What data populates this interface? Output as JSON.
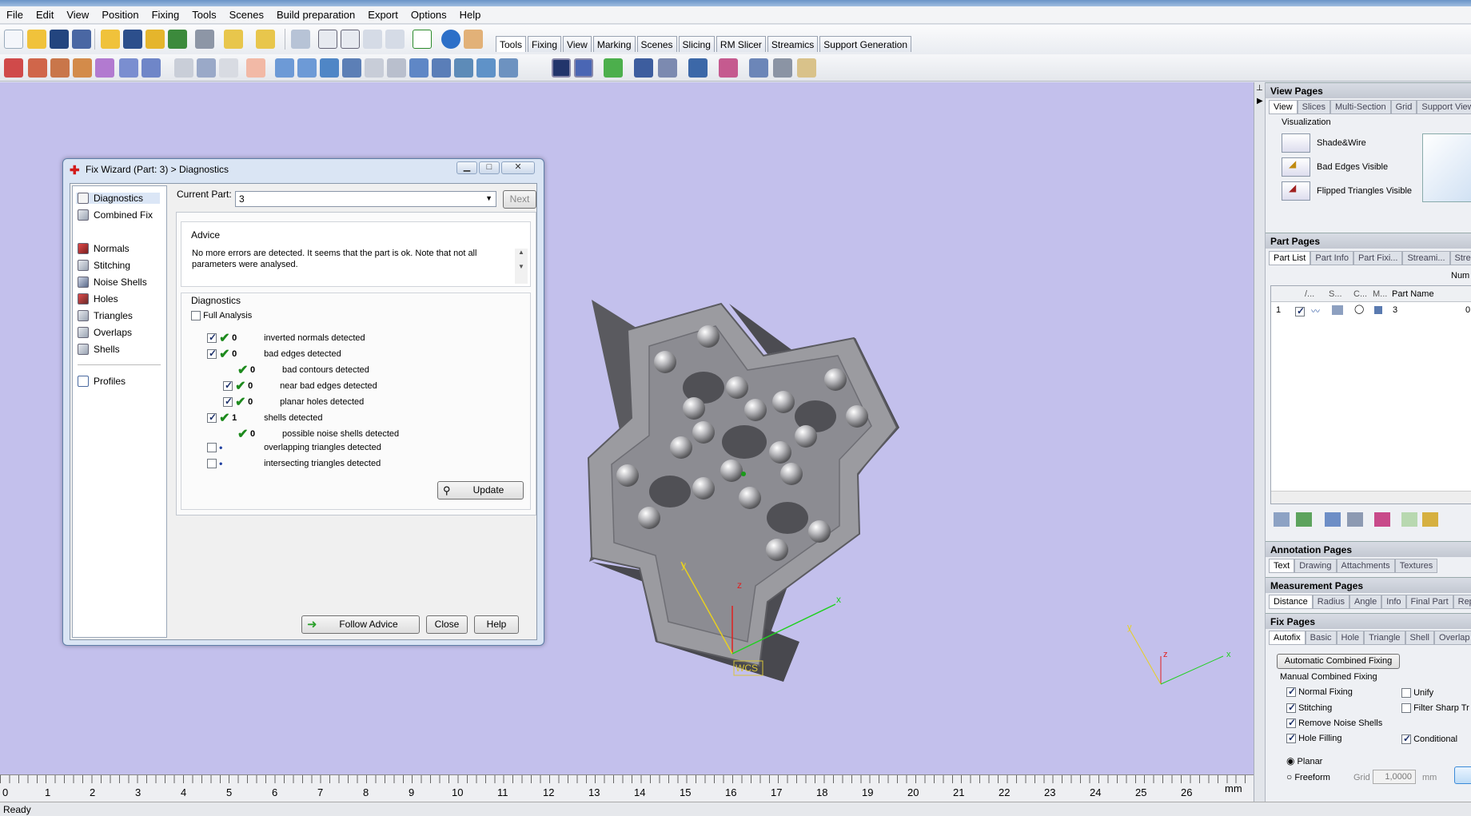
{
  "menu": [
    "File",
    "Edit",
    "View",
    "Position",
    "Fixing",
    "Tools",
    "Scenes",
    "Build preparation",
    "Export",
    "Options",
    "Help"
  ],
  "toolbar_tabs": [
    {
      "label": "Tools",
      "active": true
    },
    {
      "label": "Fixing"
    },
    {
      "label": "View"
    },
    {
      "label": "Marking"
    },
    {
      "label": "Scenes"
    },
    {
      "label": "Slicing"
    },
    {
      "label": "RM Slicer"
    },
    {
      "label": "Streamics"
    },
    {
      "label": "Support Generation"
    }
  ],
  "dialog": {
    "title": "Fix Wizard (Part: 3) > Diagnostics",
    "nav": [
      "Diagnostics",
      "Combined Fix",
      "Normals",
      "Stitching",
      "Noise Shells",
      "Holes",
      "Triangles",
      "Overlaps",
      "Shells",
      "Profiles"
    ],
    "current_part_label": "Current Part:",
    "current_part_value": "3",
    "next_label": "Next",
    "advice_title": "Advice",
    "advice_text": "No more errors are detected. It seems that the part is ok. Note that not all parameters were analysed.",
    "diagnostics_title": "Diagnostics",
    "full_analysis": "Full Analysis",
    "rows": [
      {
        "count": "0",
        "label": "inverted normals detected"
      },
      {
        "count": "0",
        "label": "bad edges detected"
      },
      {
        "count": "0",
        "label": "bad contours detected"
      },
      {
        "count": "0",
        "label": "near bad edges detected"
      },
      {
        "count": "0",
        "label": "planar holes detected"
      },
      {
        "count": "1",
        "label": "shells detected"
      },
      {
        "count": "0",
        "label": "possible noise shells detected"
      },
      {
        "count": "",
        "label": "overlapping triangles detected"
      },
      {
        "count": "",
        "label": "intersecting triangles detected"
      }
    ],
    "update": "Update",
    "follow_advice": "Follow Advice",
    "close": "Close",
    "help": "Help"
  },
  "viewport": {
    "wcs_label": "WCS",
    "axis_x": "x",
    "axis_y": "y",
    "axis_z": "z"
  },
  "ruler": {
    "ticks": [
      "0",
      "1",
      "2",
      "3",
      "4",
      "5",
      "6",
      "7",
      "8",
      "9",
      "10",
      "11",
      "12",
      "13",
      "14",
      "15",
      "16",
      "17",
      "18",
      "19",
      "20",
      "21",
      "22",
      "23",
      "24",
      "25",
      "26"
    ],
    "unit": "mm"
  },
  "status": "Ready",
  "right": {
    "view_pages": "View Pages",
    "view_tabs": [
      "View",
      "Slices",
      "Multi-Section",
      "Grid",
      "Support View"
    ],
    "visualization": "Visualization",
    "viz_items": [
      "Shade&Wire",
      "Bad Edges Visible",
      "Flipped Triangles Visible"
    ],
    "part_pages": "Part Pages",
    "part_tabs": [
      "Part List",
      "Part Info",
      "Part Fixi...",
      "Streami...",
      "Strea"
    ],
    "num_label": "Num",
    "col_part_name": "Part Name",
    "row_index": "1",
    "row_name": "3",
    "row_last": "0",
    "annotation_pages": "Annotation Pages",
    "annotation_tabs": [
      "Text",
      "Drawing",
      "Attachments",
      "Textures"
    ],
    "measurement_pages": "Measurement Pages",
    "measurement_tabs": [
      "Distance",
      "Radius",
      "Angle",
      "Info",
      "Final Part",
      "Rep"
    ],
    "fix_pages": "Fix Pages",
    "fix_tabs": [
      "Autofix",
      "Basic",
      "Hole",
      "Triangle",
      "Shell",
      "Overlap"
    ],
    "auto_combined": "Automatic Combined Fixing",
    "manual_combined": "Manual Combined Fixing",
    "normal_fixing": "Normal Fixing",
    "stitching": "Stitching",
    "remove_noise": "Remove Noise Shells",
    "hole_filling": "Hole Filling",
    "unify": "Unify",
    "filter_sharp": "Filter Sharp Tr",
    "conditional": "Conditional",
    "planar": "Planar",
    "freeform": "Freeform",
    "grid_label": "Grid",
    "grid_value": "1,0000",
    "mm": "mm"
  }
}
